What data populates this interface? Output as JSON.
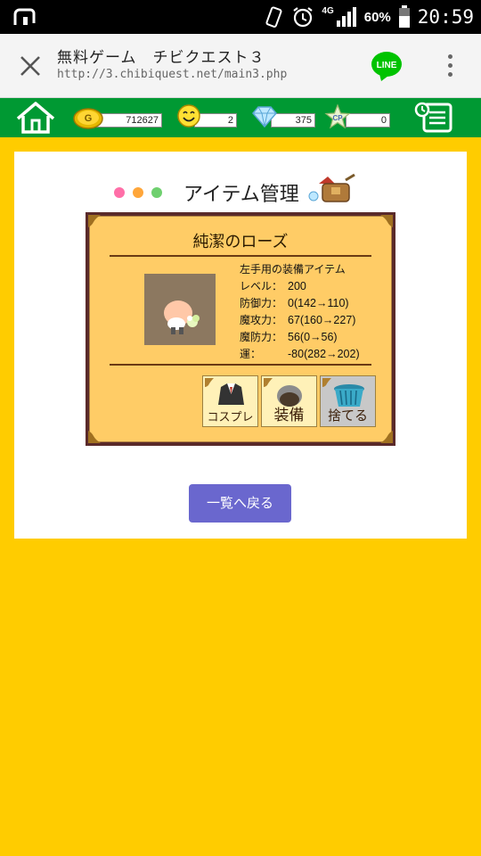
{
  "status_bar": {
    "network": "4G",
    "battery_percent": "60%",
    "time": "20:59",
    "icons": [
      "cast-icon",
      "vibrate-icon",
      "alarm-icon",
      "signal-icon",
      "battery-icon"
    ]
  },
  "browser": {
    "page_title": "無料ゲーム　チビクエスト３",
    "url": "http://3.chibiquest.net/main3.php",
    "share_label": "LINE",
    "line_color": "#00C300"
  },
  "game_header": {
    "gold": "712627",
    "smile": "2",
    "diamond": "375",
    "cp": "0",
    "cp_icon_text": "CP",
    "gold_icon_text": "G"
  },
  "page": {
    "title": "アイテム管理"
  },
  "item": {
    "name": "純潔のローズ",
    "type": "左手用の装備アイテム",
    "stats": [
      {
        "label": "レベル：",
        "value": "200"
      },
      {
        "label": "防御力：",
        "value": "0(142→110)"
      },
      {
        "label": "魔攻力：",
        "value": "67(160→227)"
      },
      {
        "label": "魔防力：",
        "value": "56(0→56)"
      },
      {
        "label": "運：",
        "value": "-80(282→202)"
      }
    ]
  },
  "actions": {
    "cosplay": "コスプレ",
    "equip": "装備",
    "discard": "捨てる"
  },
  "back_button": "一覧へ戻る",
  "colors": {
    "background": "#FFCC00",
    "header_green": "#009933",
    "card_fill": "#FFCC66",
    "back_button": "#6A67CE"
  }
}
